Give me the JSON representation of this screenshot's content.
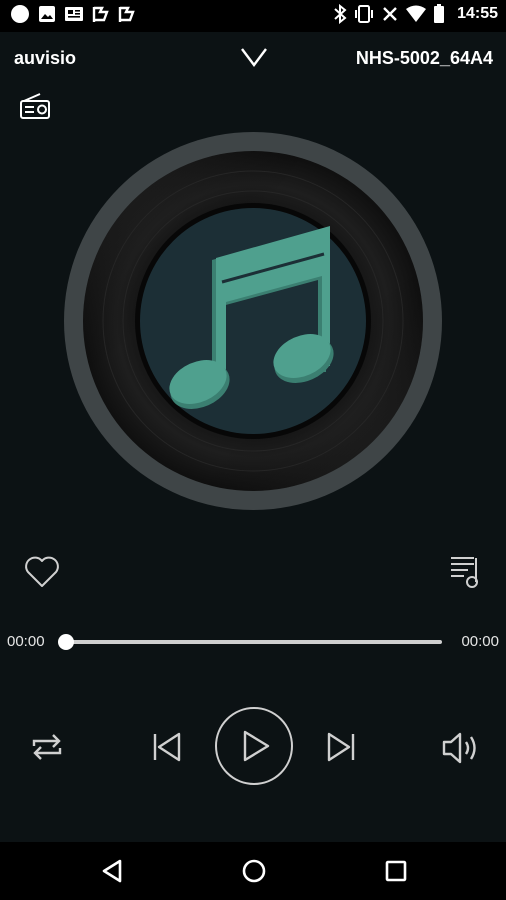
{
  "status_bar": {
    "time": "14:55",
    "left_icons": [
      "notification-dot-icon",
      "image-icon",
      "news-icon",
      "flag-icon",
      "flag-icon"
    ],
    "right_icons": [
      "bluetooth-icon",
      "vibrate-icon",
      "close-icon",
      "wifi-icon",
      "battery-icon"
    ]
  },
  "header": {
    "app_name": "auvisio",
    "device_name": "NHS-5002_64A4"
  },
  "player": {
    "elapsed": "00:00",
    "total": "00:00",
    "progress": 0,
    "favorite": false
  },
  "colors": {
    "background": "#0c1214",
    "accent": "#4a9e8c",
    "disc_center": "#1c2f36"
  },
  "icons": {
    "radio": "radio-icon",
    "collapse": "chevron-down-icon",
    "favorite": "heart-icon",
    "playlist": "playlist-icon",
    "repeat": "repeat-icon",
    "previous": "skip-previous-icon",
    "play": "play-icon",
    "next": "skip-next-icon",
    "volume": "volume-icon"
  }
}
